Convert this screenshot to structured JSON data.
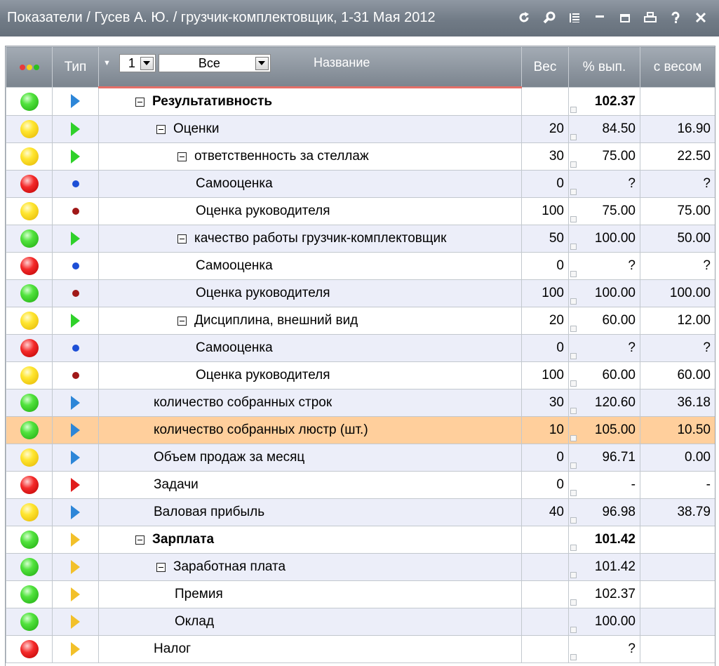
{
  "window": {
    "title": "Показатели / Гусев А. Ю. / грузчик-комплектовщик, 1-31 Мая 2012",
    "icons": [
      "refresh-icon",
      "search-icon",
      "list-icon",
      "minimize-icon",
      "maximize-icon",
      "print-icon",
      "help-icon",
      "close-icon"
    ]
  },
  "header": {
    "type_label": "Тип",
    "level_value": "1",
    "filter_value": "Все",
    "name_label": "Название",
    "weight_label": "Вес",
    "pct_label": "% вып.",
    "weighted_label": "с весом"
  },
  "colors": {
    "status_green": "#36c826",
    "status_yellow": "#ffd21c",
    "status_red": "#e01d1d",
    "selected_row": "#ffcf9c",
    "alt_row": "#eceef9",
    "header": "#8a929c",
    "accent_underline": "#e56f68"
  },
  "rows": [
    {
      "status": "green",
      "type": "tri-blue",
      "level": 0,
      "toggle": true,
      "name": "Результативность",
      "bold": true,
      "weight": "",
      "pct": "102.37",
      "pct_bold": true,
      "weighted": ""
    },
    {
      "status": "yellow",
      "type": "tri-green",
      "level": 1,
      "toggle": true,
      "name": "Оценки",
      "bold": false,
      "weight": "20",
      "pct": "84.50",
      "pct_bold": false,
      "weighted": "16.90"
    },
    {
      "status": "yellow",
      "type": "tri-green",
      "level": 2,
      "toggle": true,
      "name": "ответственность за стеллаж",
      "bold": false,
      "weight": "30",
      "pct": "75.00",
      "pct_bold": false,
      "weighted": "22.50"
    },
    {
      "status": "red",
      "type": "dot-blue",
      "level": 3,
      "toggle": false,
      "name": "Самооценка",
      "bold": false,
      "weight": "0",
      "pct": "?",
      "pct_bold": false,
      "weighted": "?"
    },
    {
      "status": "yellow",
      "type": "dot-red",
      "level": 3,
      "toggle": false,
      "name": "Оценка руководителя",
      "bold": false,
      "weight": "100",
      "pct": "75.00",
      "pct_bold": false,
      "weighted": "75.00"
    },
    {
      "status": "green",
      "type": "tri-green",
      "level": 2,
      "toggle": true,
      "name": "качество работы грузчик-комплектовщик",
      "bold": false,
      "weight": "50",
      "pct": "100.00",
      "pct_bold": false,
      "weighted": "50.00"
    },
    {
      "status": "red",
      "type": "dot-blue",
      "level": 3,
      "toggle": false,
      "name": "Самооценка",
      "bold": false,
      "weight": "0",
      "pct": "?",
      "pct_bold": false,
      "weighted": "?"
    },
    {
      "status": "green",
      "type": "dot-red",
      "level": 3,
      "toggle": false,
      "name": "Оценка руководителя",
      "bold": false,
      "weight": "100",
      "pct": "100.00",
      "pct_bold": false,
      "weighted": "100.00"
    },
    {
      "status": "yellow",
      "type": "tri-green",
      "level": 2,
      "toggle": true,
      "name": "Дисциплина, внешний вид",
      "bold": false,
      "weight": "20",
      "pct": "60.00",
      "pct_bold": false,
      "weighted": "12.00"
    },
    {
      "status": "red",
      "type": "dot-blue",
      "level": 3,
      "toggle": false,
      "name": "Самооценка",
      "bold": false,
      "weight": "0",
      "pct": "?",
      "pct_bold": false,
      "weighted": "?"
    },
    {
      "status": "yellow",
      "type": "dot-red",
      "level": 3,
      "toggle": false,
      "name": "Оценка руководителя",
      "bold": false,
      "weight": "100",
      "pct": "60.00",
      "pct_bold": false,
      "weighted": "60.00"
    },
    {
      "status": "green",
      "type": "tri-blue",
      "level": 4,
      "toggle": false,
      "name": "количество собранных строк",
      "bold": false,
      "weight": "30",
      "pct": "120.60",
      "pct_bold": false,
      "weighted": "36.18"
    },
    {
      "status": "green",
      "type": "tri-blue",
      "level": 4,
      "toggle": false,
      "name": "количество собранных люстр (шт.)",
      "bold": false,
      "weight": "10",
      "pct": "105.00",
      "pct_bold": false,
      "weighted": "10.50",
      "selected": true
    },
    {
      "status": "yellow",
      "type": "tri-blue",
      "level": 4,
      "toggle": false,
      "name": "Объем продаж за месяц",
      "bold": false,
      "weight": "0",
      "pct": "96.71",
      "pct_bold": false,
      "weighted": "0.00"
    },
    {
      "status": "red",
      "type": "tri-red",
      "level": 4,
      "toggle": false,
      "name": "Задачи",
      "bold": false,
      "weight": "0",
      "pct": "-",
      "pct_bold": false,
      "weighted": "-"
    },
    {
      "status": "yellow",
      "type": "tri-blue",
      "level": 4,
      "toggle": false,
      "name": "Валовая прибыль",
      "bold": false,
      "weight": "40",
      "pct": "96.98",
      "pct_bold": false,
      "weighted": "38.79"
    },
    {
      "status": "green",
      "type": "tri-orange",
      "level": 0,
      "toggle": true,
      "name": "Зарплата",
      "bold": true,
      "weight": "",
      "pct": "101.42",
      "pct_bold": true,
      "weighted": ""
    },
    {
      "status": "green",
      "type": "tri-orange",
      "level": 1,
      "toggle": true,
      "name": "Заработная плата",
      "bold": false,
      "weight": "",
      "pct": "101.42",
      "pct_bold": false,
      "weighted": ""
    },
    {
      "status": "green",
      "type": "tri-orange",
      "level": 5,
      "toggle": false,
      "name": "Премия",
      "bold": false,
      "weight": "",
      "pct": "102.37",
      "pct_bold": false,
      "weighted": ""
    },
    {
      "status": "green",
      "type": "tri-orange",
      "level": 5,
      "toggle": false,
      "name": "Оклад",
      "bold": false,
      "weight": "",
      "pct": "100.00",
      "pct_bold": false,
      "weighted": ""
    },
    {
      "status": "red",
      "type": "tri-orange",
      "level": 4,
      "toggle": false,
      "name": "Налог",
      "bold": false,
      "weight": "",
      "pct": "?",
      "pct_bold": false,
      "weighted": ""
    }
  ]
}
